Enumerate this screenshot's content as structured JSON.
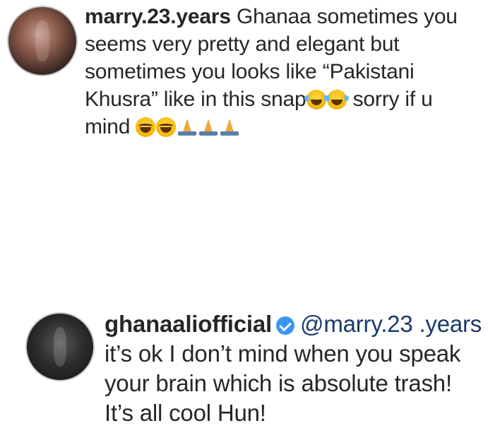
{
  "comments": [
    {
      "username": "marry.23.years",
      "text_part1": " Ghanaa sometimes you seems very pretty and elegant but sometimes you looks like “Pakistani Khusra” like in this snap",
      "text_part2": " sorry if u mind",
      "emojis_after_part1": [
        "face-with-tears-of-joy-icon",
        "face-with-tears-of-joy-icon"
      ],
      "emojis_after_part2": [
        "grinning-face-icon",
        "smiling-face-icon",
        "folded-hands-icon",
        "folded-hands-icon",
        "folded-hands-icon"
      ]
    },
    {
      "username": "ghanaaliofficial",
      "verified": true,
      "mention": "@marry.23 .years",
      "text": " it’s ok I don’t mind when you speak your brain which is absolute trash! It’s all cool Hun!"
    }
  ],
  "colors": {
    "text": "#262626",
    "mention": "#1a3a6b",
    "verified_badge": "#3897f0"
  }
}
